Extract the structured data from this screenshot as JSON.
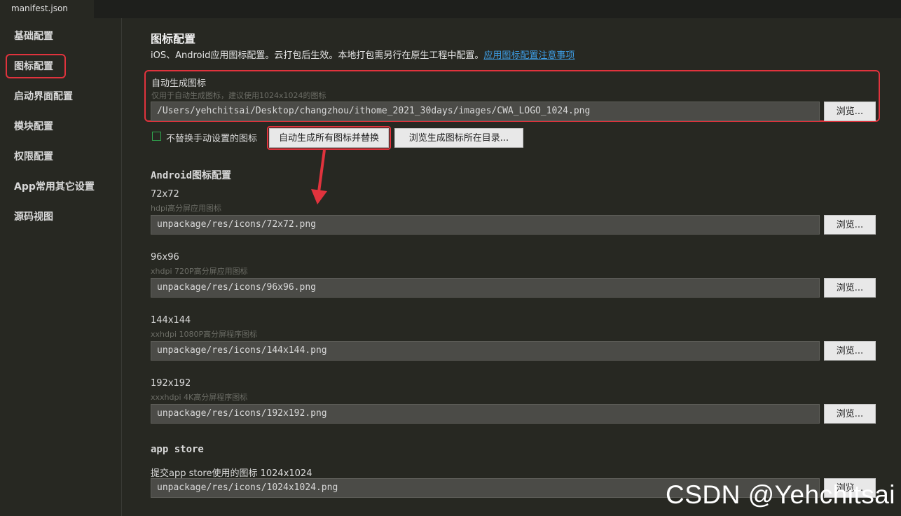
{
  "tab": {
    "title": "manifest.json"
  },
  "sidebar": {
    "items": [
      {
        "label": "基础配置"
      },
      {
        "label": "图标配置"
      },
      {
        "label": "启动界面配置"
      },
      {
        "label": "模块配置"
      },
      {
        "label": "权限配置"
      },
      {
        "label": "App常用其它设置"
      },
      {
        "label": "源码视图"
      }
    ],
    "active": "图标配置"
  },
  "main": {
    "title": "图标配置",
    "description": "iOS、Android应用图标配置。云打包后生效。本地打包需另行在原生工程中配置。",
    "description_link": "应用图标配置注意事项",
    "auto": {
      "label": "自动生成图标",
      "sublabel": "仅用于自动生成图标，建议使用1024x1024的图标",
      "path": "/Users/yehchitsai/Desktop/changzhou/ithome_2021_30days/images/CWA_LOGO_1024.png",
      "browse_label": "浏览..."
    },
    "options": {
      "no_replace_label": "不替换手动设置的图标",
      "no_replace_checked": false,
      "generate_button": "自动生成所有图标并替换",
      "browse_dir_button": "浏览生成图标所在目录..."
    },
    "android": {
      "heading": "Android图标配置",
      "icons": [
        {
          "size": "72x72",
          "desc": "hdpi高分屏应用图标",
          "path": "unpackage/res/icons/72x72.png",
          "browse_label": "浏览..."
        },
        {
          "size": "96x96",
          "desc": "xhdpi 720P高分屏应用图标",
          "path": "unpackage/res/icons/96x96.png",
          "browse_label": "浏览..."
        },
        {
          "size": "144x144",
          "desc": "xxhdpi 1080P高分屏程序图标",
          "path": "unpackage/res/icons/144x144.png",
          "browse_label": "浏览..."
        },
        {
          "size": "192x192",
          "desc": "xxxhdpi 4K高分屏程序图标",
          "path": "unpackage/res/icons/192x192.png",
          "browse_label": "浏览..."
        }
      ]
    },
    "appstore": {
      "heading": "app store",
      "label": "提交app store使用的图标 1024x1024",
      "path": "unpackage/res/icons/1024x1024.png",
      "browse_label": "浏览..."
    }
  },
  "watermark": "CSDN @Yehchitsai",
  "colors": {
    "highlight": "#e0333d",
    "link": "#3e9ee6",
    "background": "#272822"
  }
}
